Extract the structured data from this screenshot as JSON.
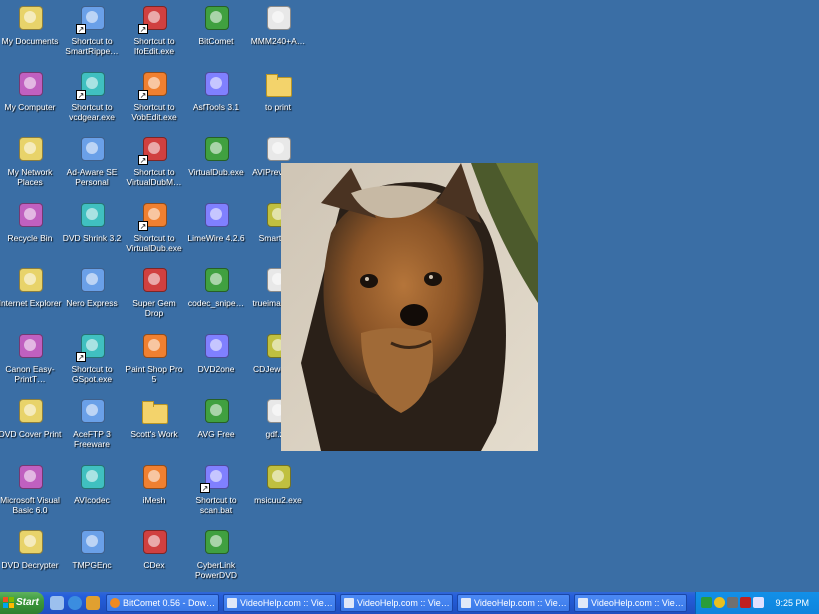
{
  "desktop": {
    "icons": [
      {
        "label": "My Documents",
        "icon": "my-documents-icon"
      },
      {
        "label": "Shortcut to SmartRippe…",
        "icon": "smartripper-icon"
      },
      {
        "label": "Shortcut to IfoEdit.exe",
        "icon": "ifoedit-icon"
      },
      {
        "label": "BitComet",
        "icon": "bitcomet-icon"
      },
      {
        "label": "MMM240+A…",
        "icon": "pdf-file-icon"
      },
      {
        "label": "My Computer",
        "icon": "my-computer-icon"
      },
      {
        "label": "Shortcut to vcdgear.exe",
        "icon": "vcdgear-icon"
      },
      {
        "label": "Shortcut to VobEdit.exe",
        "icon": "vobedit-icon"
      },
      {
        "label": "AsfTools 3.1",
        "icon": "asftools-icon"
      },
      {
        "label": "to print",
        "icon": "folder-icon"
      },
      {
        "label": "My Network Places",
        "icon": "network-places-icon"
      },
      {
        "label": "Ad-Aware SE Personal",
        "icon": "adaware-icon"
      },
      {
        "label": "Shortcut to VirtualDubM…",
        "icon": "virtualdubmod-icon"
      },
      {
        "label": "VirtualDub.exe",
        "icon": "virtualdub-icon"
      },
      {
        "label": "AVIPreview…",
        "icon": "avipreview-icon"
      },
      {
        "label": "Recycle Bin",
        "icon": "recycle-bin-icon"
      },
      {
        "label": "DVD Shrink 3.2",
        "icon": "dvdshrink-icon"
      },
      {
        "label": "Shortcut to VirtualDub.exe",
        "icon": "virtualdub-gear-icon"
      },
      {
        "label": "LimeWire 4.2.6",
        "icon": "limewire-icon"
      },
      {
        "label": "SmartFTP",
        "icon": "smartftp-icon"
      },
      {
        "label": "Internet Explorer",
        "icon": "internet-explorer-icon"
      },
      {
        "label": "Nero Express",
        "icon": "nero-icon"
      },
      {
        "label": "Super Gem Drop",
        "icon": "gem-icon"
      },
      {
        "label": "codec_snipe…",
        "icon": "codec-sniper-icon"
      },
      {
        "label": "trueimage8…",
        "icon": "trueimage-icon"
      },
      {
        "label": "Canon Easy-PrintT…",
        "icon": "canon-icon"
      },
      {
        "label": "Shortcut to GSpot.exe",
        "icon": "gspot-icon"
      },
      {
        "label": "Paint Shop Pro 5",
        "icon": "paintshop-icon"
      },
      {
        "label": "DVD2one",
        "icon": "dvd2one-icon"
      },
      {
        "label": "CDJewel.exe",
        "icon": "cdjewel-icon"
      },
      {
        "label": "DVD Cover Print",
        "icon": "dvd-cover-icon"
      },
      {
        "label": "AceFTP 3 Freeware",
        "icon": "aceftp-icon"
      },
      {
        "label": "Scott's Work",
        "icon": "folder-icon"
      },
      {
        "label": "AVG Free",
        "icon": "avg-icon"
      },
      {
        "label": "gdf.zip",
        "icon": "zip-file-icon"
      },
      {
        "label": "Microsoft Visual Basic 6.0",
        "icon": "visual-basic-icon"
      },
      {
        "label": "AVIcodec",
        "icon": "avicodec-icon"
      },
      {
        "label": "iMesh",
        "icon": "imesh-icon"
      },
      {
        "label": "Shortcut to scan.bat",
        "icon": "batch-file-icon"
      },
      {
        "label": "msicuu2.exe",
        "icon": "msicuu-icon"
      },
      {
        "label": "DVD Decrypter",
        "icon": "dvd-decrypter-icon"
      },
      {
        "label": "TMPGEnc",
        "icon": "tmpgenc-icon"
      },
      {
        "label": "CDex",
        "icon": "cdex-icon"
      },
      {
        "label": "CyberLink PowerDVD",
        "icon": "powerdvd-icon"
      }
    ]
  },
  "taskbar": {
    "start_label": "Start",
    "quick_launch": [
      "show-desktop-icon",
      "internet-explorer-icon",
      "media-icon"
    ],
    "tasks": [
      {
        "label": "BitComet 0.56 - Dow…",
        "icon": "bitcomet-icon"
      },
      {
        "label": "VideoHelp.com :: Vie…",
        "icon": "browser-window-icon"
      },
      {
        "label": "VideoHelp.com :: Vie…",
        "icon": "browser-window-icon"
      },
      {
        "label": "VideoHelp.com :: Vie…",
        "icon": "browser-window-icon"
      },
      {
        "label": "VideoHelp.com :: Vie…",
        "icon": "browser-window-icon"
      }
    ],
    "clock": "9:25 PM"
  },
  "colors": {
    "desktop_bg": "#3a6ea5",
    "taskbar": "#245edb",
    "start": "#3c9a3c",
    "tray": "#0f84dd"
  }
}
